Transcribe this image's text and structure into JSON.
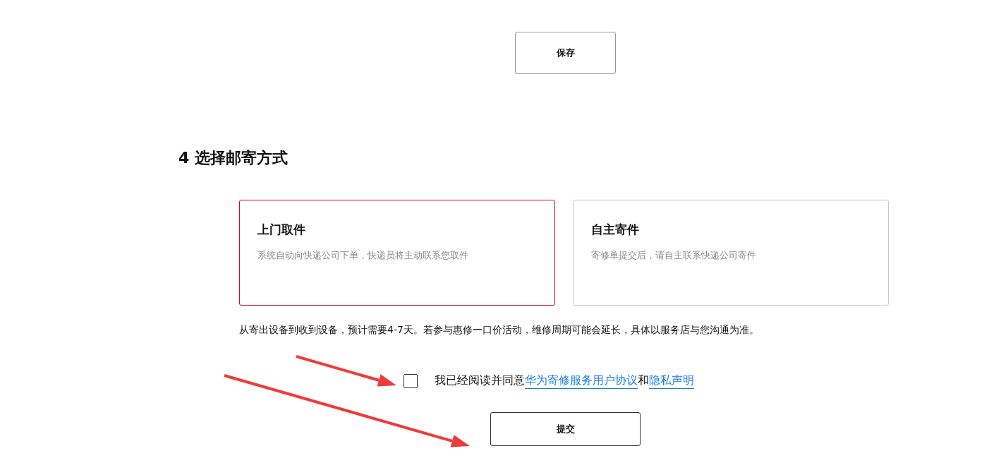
{
  "save_button": "保存",
  "section": {
    "title": "4 选择邮寄方式",
    "options": [
      {
        "title": "上门取件",
        "description": "系统自动向快递公司下单，快递员将主动联系您取件",
        "selected": true
      },
      {
        "title": "自主寄件",
        "description": "寄修单提交后，请自主联系快递公司寄件",
        "selected": false
      }
    ],
    "note": "从寄出设备到收到设备，预计需要4-7天。若参与惠修一口价活动，维修周期可能会延长，具体以服务店与您沟通为准。"
  },
  "agreement": {
    "checked": false,
    "text": "我已经阅读并同意",
    "links": [
      "华为寄修服务用户协议",
      "隐私声明"
    ],
    "conjunction": "和"
  },
  "submit_button": "提交"
}
